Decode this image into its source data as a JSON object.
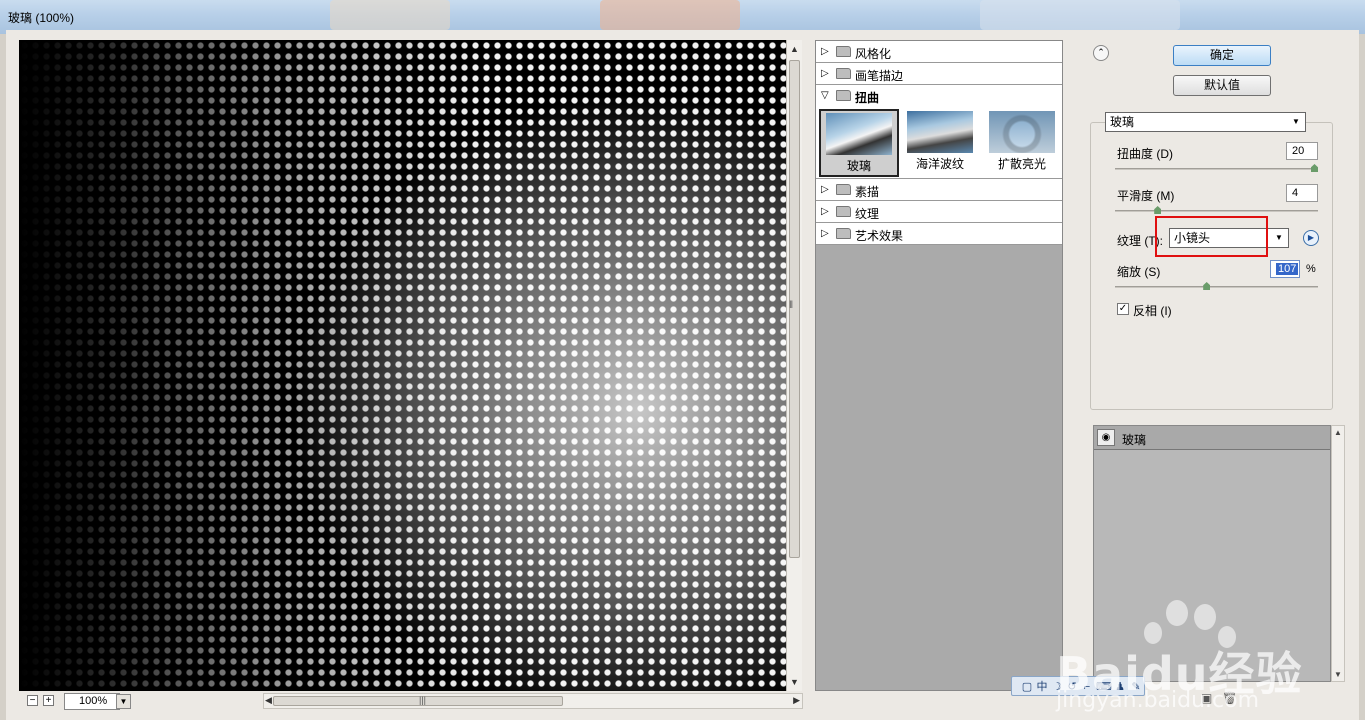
{
  "window": {
    "title": "玻璃 (100%)"
  },
  "preview": {
    "zoom": "100%",
    "zoom_out_symbol": "−",
    "zoom_in_symbol": "+"
  },
  "filter_tree": {
    "categories": [
      {
        "label": "风格化",
        "expanded": false
      },
      {
        "label": "画笔描边",
        "expanded": false
      },
      {
        "label": "扭曲",
        "expanded": true
      },
      {
        "label": "素描",
        "expanded": false
      },
      {
        "label": "纹理",
        "expanded": false
      },
      {
        "label": "艺术效果",
        "expanded": false
      }
    ],
    "distort_filters": [
      {
        "label": "玻璃",
        "selected": true
      },
      {
        "label": "海洋波纹",
        "selected": false
      },
      {
        "label": "扩散亮光",
        "selected": false
      }
    ]
  },
  "buttons": {
    "ok": "确定",
    "default": "默认值"
  },
  "settings": {
    "filter_select": "玻璃",
    "distortion": {
      "label": "扭曲度 (D)",
      "value": "20",
      "level": 1.0
    },
    "smoothness": {
      "label": "平滑度 (M)",
      "value": "4",
      "level": 0.2
    },
    "texture": {
      "label": "纹理 (T):",
      "value": "小镜头"
    },
    "scaling": {
      "label": "缩放 (S)",
      "value": "107",
      "unit": "%",
      "level": 0.45
    },
    "invert": {
      "label": "反相 (I)",
      "checked": true
    }
  },
  "layers": {
    "items": [
      {
        "name": "玻璃",
        "visible": true
      }
    ]
  },
  "watermark": {
    "text": "Baidu经验",
    "subtext": "jingyan.baidu.com"
  },
  "colors": {
    "highlight_box": "#e01010",
    "accent": "#3567c9"
  }
}
